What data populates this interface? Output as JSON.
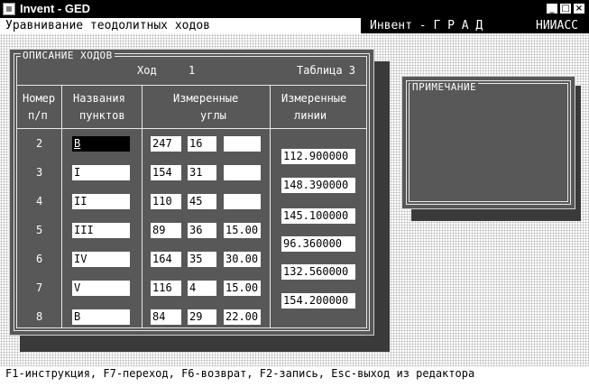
{
  "window": {
    "title": "Invent - GED",
    "min": "_",
    "max": "□",
    "close": "×"
  },
  "header": {
    "left": "Уравнивание теодолитных ходов",
    "brand": "Инвент - Г Р А Д",
    "institute": "НИИАСС"
  },
  "main_panel": {
    "title": "ОПИСАНИЕ ХОДОВ",
    "hod_label": "Ход",
    "hod_value": "1",
    "table_label": "Таблица 3",
    "columns": {
      "num_line1": "Номер",
      "num_line2": "п/п",
      "names_line1": "Названия",
      "names_line2": "пунктов",
      "angles_line1": "Измеренные",
      "angles_line2": "углы",
      "lines_line1": "Измеренные",
      "lines_line2": "линии"
    },
    "rows": [
      {
        "num": "2",
        "name": "B",
        "deg": "247",
        "min": "16",
        "sec": ""
      },
      {
        "num": "3",
        "name": "I",
        "deg": "154",
        "min": "31",
        "sec": ""
      },
      {
        "num": "4",
        "name": "II",
        "deg": "110",
        "min": "45",
        "sec": ""
      },
      {
        "num": "5",
        "name": "III",
        "deg": "89",
        "min": "36",
        "sec": "15.00"
      },
      {
        "num": "6",
        "name": "IV",
        "deg": "164",
        "min": "35",
        "sec": "30.00"
      },
      {
        "num": "7",
        "name": "V",
        "deg": "116",
        "min": "4",
        "sec": "15.00"
      },
      {
        "num": "8",
        "name": "B",
        "deg": "84",
        "min": "29",
        "sec": "22.00"
      }
    ],
    "lines": [
      "112.900000",
      "148.390000",
      "145.100000",
      "96.360000",
      "132.560000",
      "154.200000"
    ]
  },
  "note_panel": {
    "title": "ПРИМЕЧАНИЕ"
  },
  "status": "F1-инструкция, F7-переход, F6-возврат, F2-запись, Esc-выход из редактора"
}
